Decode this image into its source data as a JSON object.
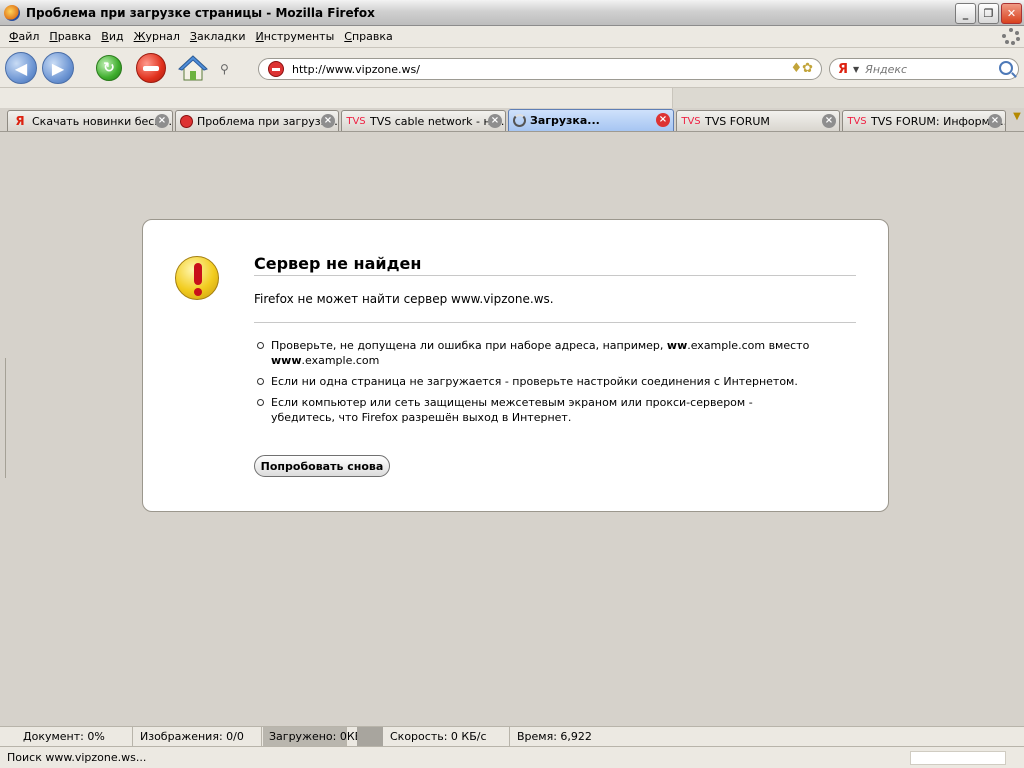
{
  "window": {
    "title": "Проблема при загрузке страницы - Mozilla Firefox"
  },
  "menu": [
    "Файл",
    "Правка",
    "Вид",
    "Журнал",
    "Закладки",
    "Инструменты",
    "Справка"
  ],
  "navbar": {
    "url": "http://www.vipzone.ws/",
    "search_engine_glyph": "Я",
    "search_placeholder": "Яндекс"
  },
  "tabs": [
    {
      "favicon": "Я",
      "label": "Скачать новинки бесп..."
    },
    {
      "favicon": "",
      "label": "Проблема при загрузк..."
    },
    {
      "favicon": "TVS",
      "label": "TVS cable network - но..."
    },
    {
      "favicon": "",
      "label": "Загрузка..."
    },
    {
      "favicon": "TVS",
      "label": "TVS FORUM"
    },
    {
      "favicon": "TVS",
      "label": "TVS FORUM: Информа..."
    }
  ],
  "error_page": {
    "title": "Сервер не найден",
    "description": "Firefox не может найти сервер www.vipzone.ws.",
    "bullets": [
      {
        "pre": "Проверьте, не допущена ли ошибка при наборе адреса, например, ",
        "b1": "ww",
        "mid": ".example.com вместо ",
        "b2": "www",
        "post": ".example.com"
      },
      {
        "text": "Если ни одна страница не загружается - проверьте настройки соединения с Интернетом."
      },
      {
        "text": "Если компьютер или сеть защищены межсетевым экраном или прокси-сервером - убедитесь, что Firefox разрешён выход в Интернет."
      }
    ],
    "button_label": "Попробовать снова"
  },
  "statusbar": {
    "document": "Документ: 0%",
    "images": "Изображения: 0/0",
    "loaded": "Загружено: 0КБ",
    "speed": "Скорость: 0 КБ/с",
    "time": "Время: 6,922",
    "status_text": "Поиск www.vipzone.ws..."
  },
  "colors": {
    "active_tab": "#a6c5f2",
    "chrome": "#ece9e2",
    "content_bg": "#d6d2cb",
    "close_red": "#d8421e"
  }
}
